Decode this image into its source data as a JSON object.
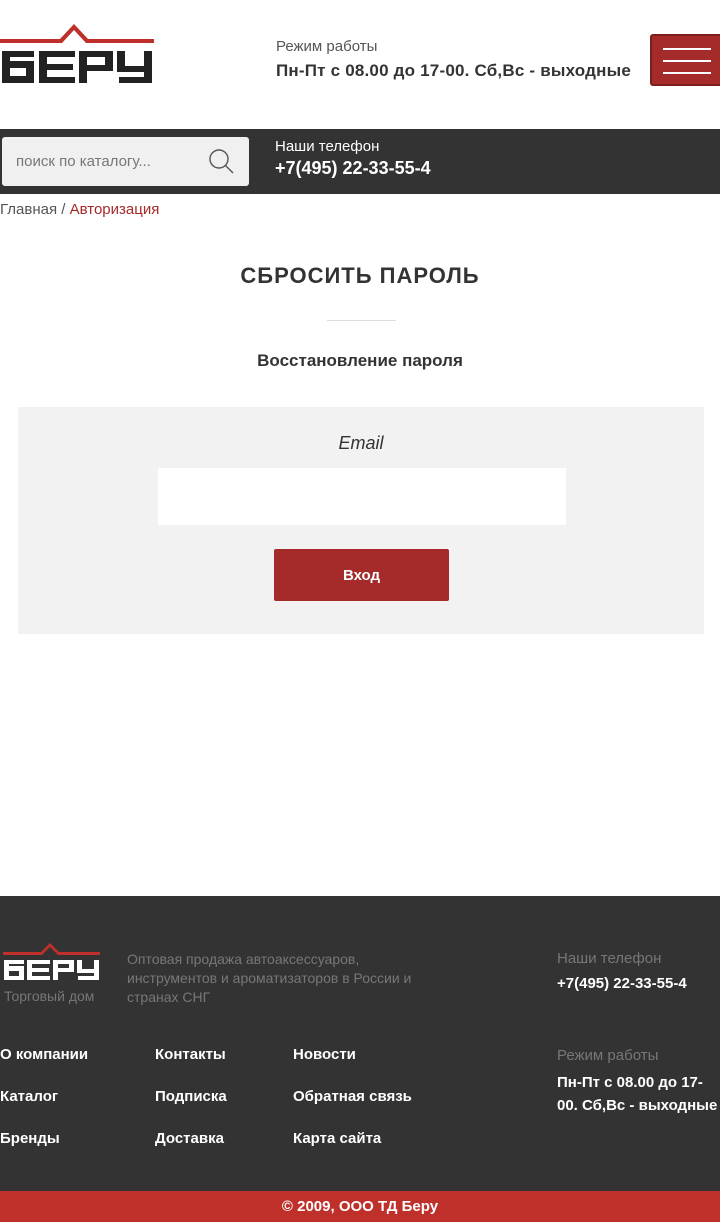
{
  "brand": {
    "name": "БЕРУ",
    "tagline": "Торговый дом",
    "accent_color": "#a52a2a",
    "dark_color": "#333333"
  },
  "header": {
    "hours_label": "Режим работы",
    "hours_value": "Пн-Пт с 08.00 до 17-00. Сб,Вс - выходные",
    "menu_icon": "hamburger-icon"
  },
  "topbar": {
    "search_placeholder": "поиск по каталогу...",
    "search_icon": "search-icon",
    "phones_label": "Наши телефон",
    "phone": "+7(495) 22-33-55-4"
  },
  "breadcrumb": {
    "home": "Главная",
    "separator": " / ",
    "current": "Авторизация"
  },
  "main": {
    "title": "СБРОСИТЬ ПАРОЛЬ",
    "subtitle": "Восстановление пароля",
    "email_label": "Email",
    "email_value": "",
    "submit_label": "Вход"
  },
  "footer": {
    "description": "Оптовая продажа автоаксессуаров, инструментов и ароматизаторов в России и странах СНГ",
    "phones_label": "Наши телефон",
    "phone": "+7(495) 22-33-55-4",
    "hours_label": "Режим работы",
    "hours_value": "Пн-Пт с 08.00 до 17-00. Сб,Вс - выходные",
    "links": [
      "О компании",
      "Контакты",
      "Новости",
      "Каталог",
      "Подписка",
      "Обратная связь",
      "Бренды",
      "Доставка",
      "Карта сайта"
    ],
    "copyright": "© 2009, ООО ТД Беру"
  }
}
